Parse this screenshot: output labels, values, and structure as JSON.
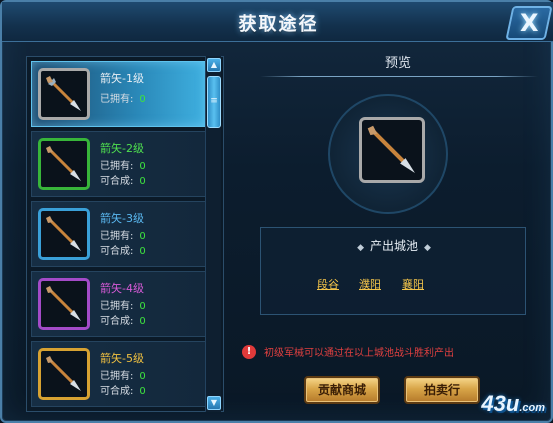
{
  "window": {
    "title": "获取途径",
    "close_label": "X"
  },
  "items": [
    {
      "name": "箭矢-1级",
      "owned_label": "已拥有:",
      "owned": "0",
      "craft_label": "",
      "craft": "",
      "quality": "white",
      "selected": true
    },
    {
      "name": "箭矢-2级",
      "owned_label": "已拥有:",
      "owned": "0",
      "craft_label": "可合成:",
      "craft": "0",
      "quality": "green",
      "selected": false
    },
    {
      "name": "箭矢-3级",
      "owned_label": "已拥有:",
      "owned": "0",
      "craft_label": "可合成:",
      "craft": "0",
      "quality": "blue",
      "selected": false
    },
    {
      "name": "箭矢-4级",
      "owned_label": "已拥有:",
      "owned": "0",
      "craft_label": "可合成:",
      "craft": "0",
      "quality": "purple",
      "selected": false
    },
    {
      "name": "箭矢-5级",
      "owned_label": "已拥有:",
      "owned": "0",
      "craft_label": "可合成:",
      "craft": "0",
      "quality": "orange",
      "selected": false
    }
  ],
  "scrollbar": {
    "up": "▲",
    "down": "▼",
    "thumb": "≡"
  },
  "preview": {
    "label": "预览"
  },
  "source": {
    "title": "产出城池",
    "dot": "◆",
    "cities": [
      "段谷",
      "濮阳",
      "襄阳"
    ]
  },
  "warning": "初级军械可以通过在以上城池战斗胜利产出",
  "warning_icon": "!",
  "buttons": {
    "shop": "贡献商城",
    "auction": "拍卖行"
  },
  "watermark": {
    "main": "43u",
    "suffix": ".com"
  }
}
